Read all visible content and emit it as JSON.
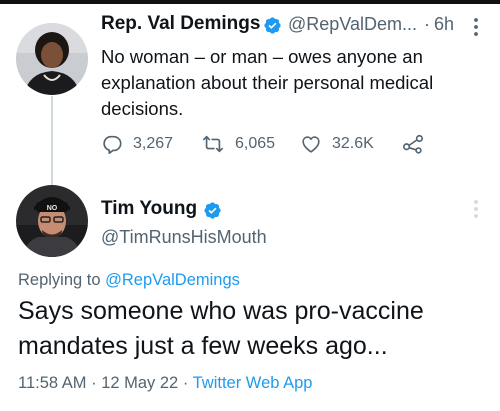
{
  "tweet1": {
    "name": "Rep. Val Demings",
    "handle": "@RepValDem...",
    "separator": "·",
    "time": "6h",
    "text": "No woman – or man – owes anyone an explanation about their personal medical decisions.",
    "stats": {
      "replies": "3,267",
      "retweets": "6,065",
      "likes": "32.6K"
    }
  },
  "tweet2": {
    "name": "Tim Young",
    "handle": "@TimRunsHisMouth",
    "replying_prefix": "Replying to ",
    "replying_to": "@RepValDemings",
    "text": "Says someone who was pro-vaccine mandates just a few weeks ago...",
    "time": "11:58 AM",
    "date": "12 May 22",
    "source": "Twitter Web App",
    "separator": "·"
  },
  "avatar2_cap_text": "NO",
  "colors": {
    "verified": "#1d9bf0",
    "link": "#1d9bf0",
    "secondary_text": "#536471",
    "primary_text": "#0f1419",
    "thread_line": "#cfd9de"
  },
  "icons": [
    "more-dots-icon",
    "verified-badge-icon",
    "reply-icon",
    "retweet-icon",
    "like-icon",
    "share-icon"
  ]
}
